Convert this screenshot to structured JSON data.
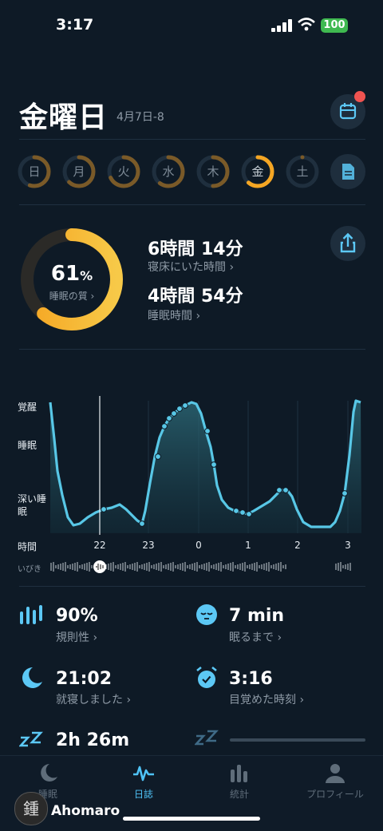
{
  "status_bar": {
    "time": "3:17",
    "battery": "100"
  },
  "header": {
    "title": "金曜日",
    "date_range": "4月7日-8"
  },
  "week": {
    "days": [
      {
        "label": "日",
        "quality": 0.55
      },
      {
        "label": "月",
        "quality": 0.62
      },
      {
        "label": "火",
        "quality": 0.68
      },
      {
        "label": "水",
        "quality": 0.6
      },
      {
        "label": "木",
        "quality": 0.5
      },
      {
        "label": "金",
        "quality": 0.61,
        "active": true
      },
      {
        "label": "土",
        "quality": 0
      }
    ]
  },
  "summary": {
    "quality_percent": "61",
    "quality_unit": "%",
    "quality_label": "睡眠の質 ›",
    "quality_fraction": 0.61,
    "time_in_bed": "6時間 14分",
    "time_in_bed_label": "寝床にいた時間 ›",
    "sleep_time": "4時間 54分",
    "sleep_time_label": "睡眠時間 ›"
  },
  "chart_data": {
    "type": "area",
    "y_labels": [
      "覚醒",
      "睡眠",
      "深い睡眠"
    ],
    "x_title": "時間",
    "snore_label": "いびき",
    "x_ticks": [
      "22",
      "23",
      "0",
      "1",
      "2",
      "3"
    ]
  },
  "stats": [
    {
      "value": "90%",
      "label": "規則性 ›",
      "icon": "regularity-bars-icon"
    },
    {
      "value": "7 min",
      "label": "眠るまで ›",
      "icon": "sleepy-face-icon"
    },
    {
      "value": "21:02",
      "label": "就寝しました ›",
      "icon": "moon-icon"
    },
    {
      "value": "3:16",
      "label": "目覚めた時刻 ›",
      "icon": "alarm-clock-icon"
    },
    {
      "value": "2h 26m",
      "label": "",
      "icon": "snore-zzz-icon"
    }
  ],
  "tabs": [
    {
      "label": "睡眠",
      "icon": "moon-icon"
    },
    {
      "label": "日誌",
      "icon": "pulse-wave-icon",
      "active": true
    },
    {
      "label": "統計",
      "icon": "bar-chart-icon"
    },
    {
      "label": "プロフィール",
      "icon": "person-icon"
    }
  ],
  "watermark": {
    "text": "Ahomaro",
    "logo_char": "鍾"
  },
  "colors": {
    "background": "#0e1a26",
    "accent": "#4fc3f7",
    "ring": "#f5a623",
    "badge": "#ef5350"
  }
}
